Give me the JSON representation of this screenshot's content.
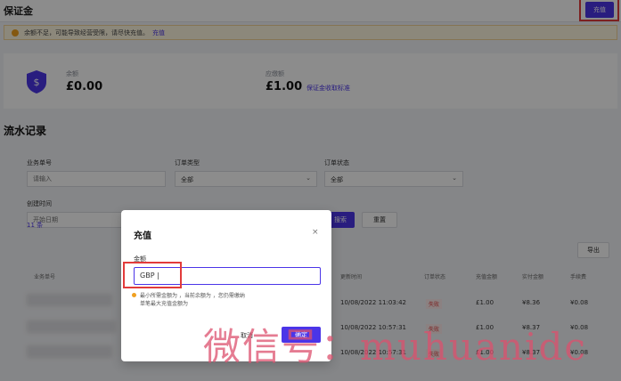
{
  "header": {
    "title": "保证金",
    "recharge_button": "充值"
  },
  "notice": {
    "text": "余额不足，可能导致经营受限，请尽快充值。",
    "link": "充值"
  },
  "balance": {
    "balance_label": "余额",
    "balance_value": "£0.00",
    "required_label": "应缴额",
    "required_value": "£1.00",
    "standard_link": "保证金收取标准"
  },
  "records": {
    "title": "流水记录",
    "filters": {
      "business_no_label": "业务单号",
      "business_no_placeholder": "请输入",
      "order_type_label": "订单类型",
      "order_type_value": "全部",
      "order_status_label": "订单状态",
      "order_status_value": "全部",
      "created_time_label": "创建时间",
      "start_date_placeholder": "开始日期",
      "search_button": "搜索",
      "reset_button": "重置"
    },
    "count": "11 条",
    "export_button": "导出",
    "columns": [
      "业务单号",
      "更新时间",
      "订单状态",
      "充值金额",
      "实付金额",
      "手续费"
    ],
    "rows": [
      {
        "time": "10/08/2022 11:03:42",
        "status": "失败",
        "amount": "£1.00",
        "paid": "¥8.36",
        "fee": "¥0.08"
      },
      {
        "time": "10/08/2022 10:57:31",
        "status": "失败",
        "amount": "£1.00",
        "paid": "¥8.37",
        "fee": "¥0.08"
      },
      {
        "time": "10/08/2022 10:57:31",
        "status": "失败",
        "amount": "£1.00",
        "paid": "¥8.37",
        "fee": "¥0.08"
      }
    ]
  },
  "modal": {
    "title": "充值",
    "close": "×",
    "amount_label": "金额",
    "currency": "GBP",
    "hint_line1": "最小所需金额为          ，当前余额为          ，您仍需缴纳",
    "hint_line2": "单笔最大充值金额为",
    "cancel_button": "取消",
    "confirm_button": "确定"
  },
  "watermark": "微信号：muhuanidc",
  "colors": {
    "primary": "#4b35e8",
    "warning": "#f0a020",
    "danger": "#e23b3b"
  }
}
